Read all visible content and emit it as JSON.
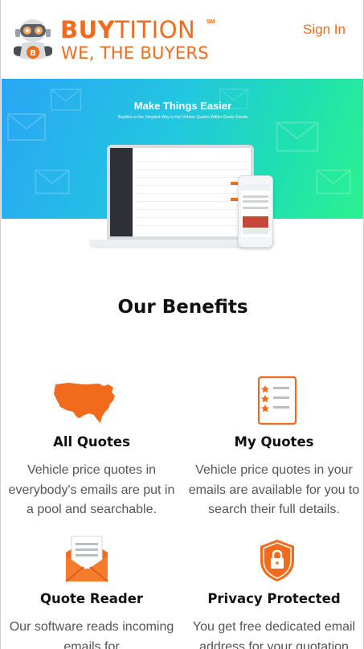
{
  "header": {
    "brand_bold": "BUY",
    "brand_light": "TITION",
    "brand_sm": "SM",
    "tagline": "WE, THE BUYERS",
    "signin_label": "Sign In"
  },
  "hero": {
    "title": "Make Things Easier",
    "subtitle": "Buytition is the Simplest Way to Get Vehicle Quotes Within Dealer Emails"
  },
  "benefits": {
    "title": "Our Benefits",
    "items": [
      {
        "title": "All Quotes",
        "description": "Vehicle price quotes in everybody's emails are put in a pool and searchable.",
        "icon": "usa-map-icon"
      },
      {
        "title": "My Quotes",
        "description": "Vehicle price quotes in your emails are available for you to search their full details.",
        "icon": "star-list-icon"
      },
      {
        "title": "Quote Reader",
        "description": "Our software reads incoming emails for",
        "icon": "envelope-letter-icon"
      },
      {
        "title": "Privacy Protected",
        "description": "You get free dedicated email address for your quotation",
        "icon": "shield-lock-icon"
      }
    ]
  },
  "colors": {
    "brand_orange": "#f26a1b",
    "hero_start": "#2aa6f4",
    "hero_end": "#2cf28f"
  }
}
